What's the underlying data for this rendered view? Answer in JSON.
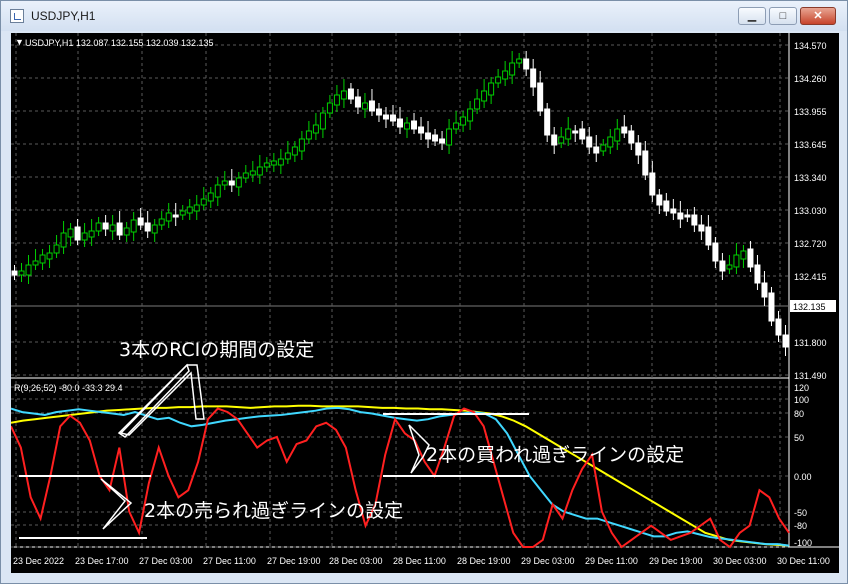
{
  "window": {
    "title": "USDJPY,H1",
    "minimize": "▁",
    "maximize": "□",
    "close": "✕"
  },
  "chart": {
    "symbol_info": "USDJPY,H1  132.087 132.155 132.039 132.135",
    "price_ticks": [
      "134.570",
      "134.260",
      "133.955",
      "133.645",
      "133.340",
      "133.030",
      "132.720",
      "132.415",
      "132.135",
      "131.800",
      "131.490"
    ],
    "current_price": "132.135",
    "time_labels": [
      "23 Dec 2022",
      "23 Dec 17:00",
      "27 Dec 03:00",
      "27 Dec 11:00",
      "27 Dec 19:00",
      "28 Dec 03:00",
      "28 Dec 11:00",
      "28 Dec 19:00",
      "29 Dec 03:00",
      "29 Dec 11:00",
      "29 Dec 19:00",
      "30 Dec 03:00",
      "30 Dec 11:00"
    ],
    "colors": {
      "background": "#000000",
      "grid": "#5a5a5a",
      "bull": "#00d000",
      "bear": "#ffffff",
      "rci_short": "#ff2020",
      "rci_mid": "#40d8ff",
      "rci_long": "#ffff00"
    }
  },
  "indicator": {
    "info": "R(9,26,52) -80.0 -33.3 29.4",
    "ticks": [
      "120",
      "100",
      "80",
      "50",
      "0.00",
      "-50",
      "-80",
      "-100"
    ]
  },
  "annotations": {
    "periods": "3本のRCIの期間の設定",
    "overbought": "2本の買われ過ぎラインの設定",
    "oversold": "2本の売られ過ぎラインの設定"
  }
}
